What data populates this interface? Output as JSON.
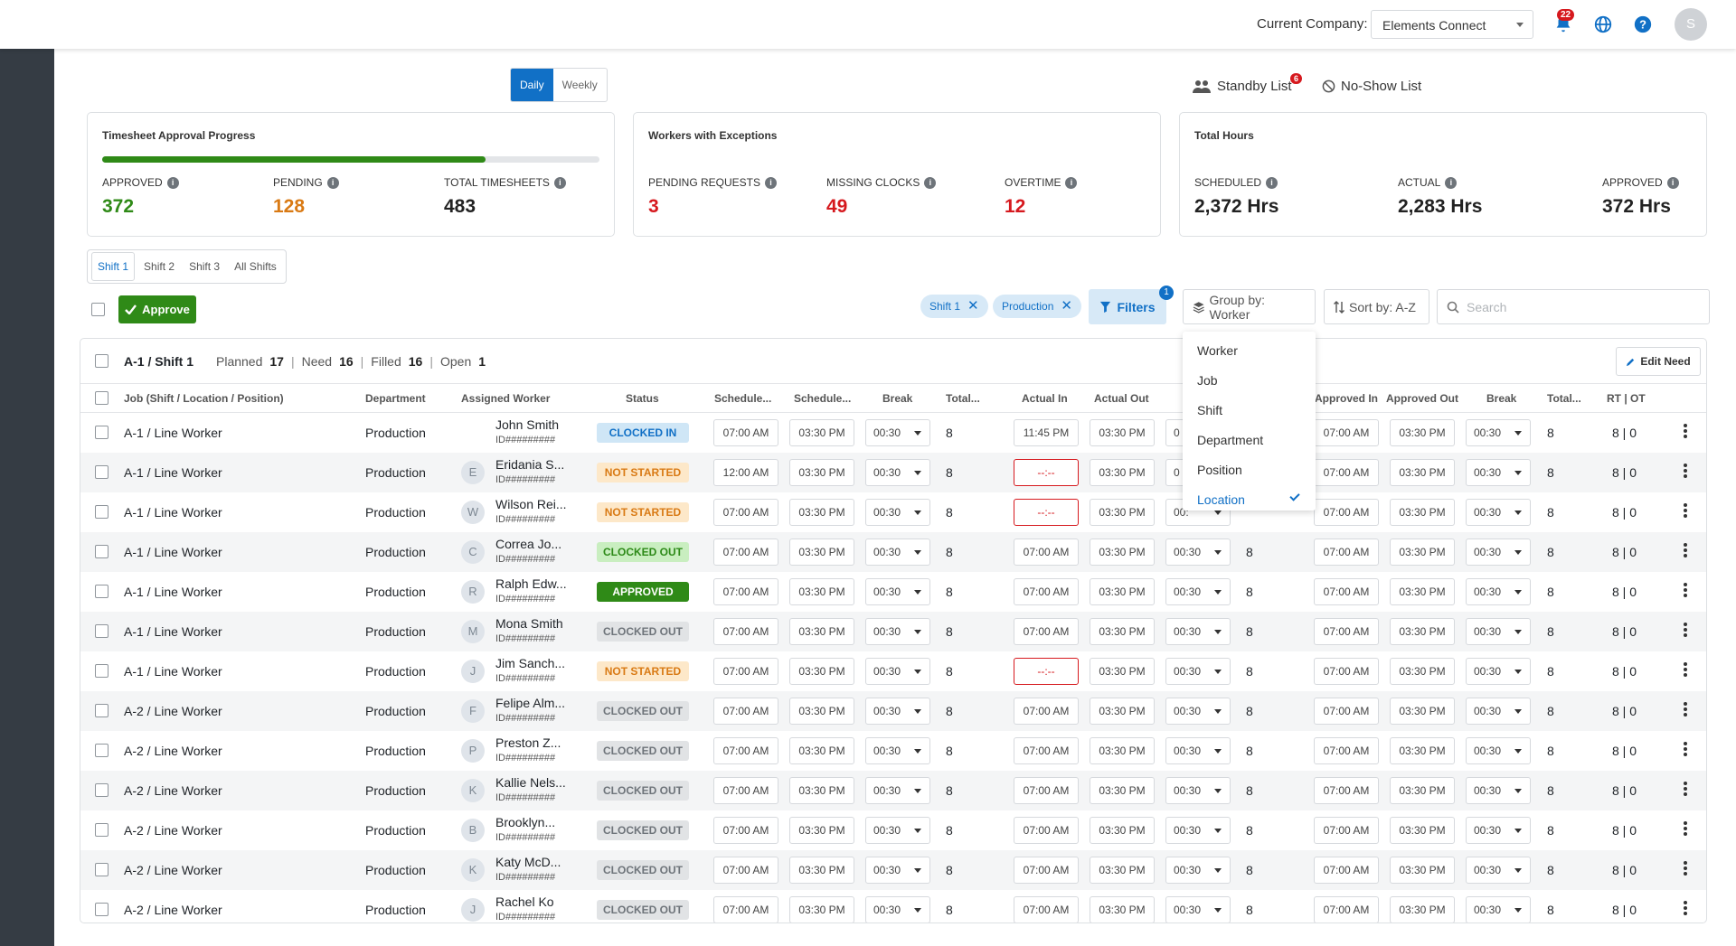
{
  "header": {
    "company_label": "Current Company:",
    "company_value": "Elements Connect",
    "notification_count": "22",
    "avatar_initial": "S"
  },
  "view_toggle": {
    "daily": "Daily",
    "weekly": "Weekly",
    "selected": "Daily"
  },
  "links": {
    "standby": "Standby List",
    "standby_count": "6",
    "noshow": "No-Show List"
  },
  "cards": {
    "approval": {
      "title": "Timesheet Approval Progress",
      "progress_fraction": 0.77,
      "metrics": [
        {
          "label": "APPROVED",
          "value": "372",
          "color": "#2f8a17"
        },
        {
          "label": "PENDING",
          "value": "128",
          "color": "#d97a14"
        },
        {
          "label": "TOTAL TIMESHEETS",
          "value": "483",
          "color": "#222222"
        }
      ]
    },
    "exceptions": {
      "title": "Workers with Exceptions",
      "metrics": [
        {
          "label": "PENDING REQUESTS",
          "value": "3",
          "color": "#d6191e"
        },
        {
          "label": "MISSING CLOCKS",
          "value": "49",
          "color": "#d6191e"
        },
        {
          "label": "OVERTIME",
          "value": "12",
          "color": "#d6191e"
        }
      ]
    },
    "hours": {
      "title": "Total Hours",
      "metrics": [
        {
          "label": "SCHEDULED",
          "value": "2,372 Hrs",
          "color": "#222222"
        },
        {
          "label": "ACTUAL",
          "value": "2,283 Hrs",
          "color": "#222222"
        },
        {
          "label": "APPROVED",
          "value": "372 Hrs",
          "color": "#222222"
        }
      ]
    }
  },
  "shift_tabs": [
    "Shift 1",
    "Shift 2",
    "Shift 3",
    "All Shifts"
  ],
  "toolbar": {
    "approve_label": "Approve",
    "chips": [
      "Shift 1",
      "Production"
    ],
    "filters_label": "Filters",
    "filters_count": "1",
    "group_by_label": "Group by: Worker",
    "sort_by_label": "Sort by: A-Z",
    "search_placeholder": "Search"
  },
  "group_by_menu": {
    "items": [
      "Worker",
      "Job",
      "Shift",
      "Department",
      "Position",
      "Location"
    ],
    "selected": "Location"
  },
  "group": {
    "name": "A-1 / Shift 1",
    "planned_label": "Planned",
    "planned": "17",
    "need_label": "Need",
    "need": "16",
    "filled_label": "Filled",
    "filled": "16",
    "open_label": "Open",
    "open": "1",
    "edit_need_label": "Edit Need"
  },
  "columns": [
    "Job (Shift / Location / Position)",
    "Department",
    "Assigned Worker",
    "Status",
    "Schedule...",
    "Schedule...",
    "Break",
    "Total...",
    "Actual In",
    "Actual Out",
    "Approved In",
    "Approved Out",
    "Break",
    "Total...",
    "RT | OT"
  ],
  "rows": [
    {
      "job": "A-1 / Line Worker",
      "dept": "Production",
      "initial": "",
      "name": "John Smith",
      "id": "ID#########",
      "status": "CLOCKED IN",
      "st": "in",
      "sin": "07:00 AM",
      "sout": "03:30 PM",
      "brk": "00:30",
      "total": "8",
      "ain": "11:45 PM",
      "aout": "03:30 PM",
      "abrk": "0",
      "atotal": "",
      "pin": "07:00 AM",
      "pout": "03:30 PM",
      "pbrk": "00:30",
      "ptotal": "8",
      "rtot": "8 | 0",
      "err": false
    },
    {
      "job": "A-1 / Line Worker",
      "dept": "Production",
      "initial": "E",
      "name": "Eridania S...",
      "id": "ID#########",
      "status": "NOT STARTED",
      "st": "ns",
      "sin": "12:00 AM",
      "sout": "03:30 PM",
      "brk": "00:30",
      "total": "8",
      "ain": "--:--",
      "aout": "03:30 PM",
      "abrk": "0",
      "atotal": "",
      "pin": "07:00 AM",
      "pout": "03:30 PM",
      "pbrk": "00:30",
      "ptotal": "8",
      "rtot": "8 | 0",
      "err": true
    },
    {
      "job": "A-1 / Line Worker",
      "dept": "Production",
      "initial": "W",
      "name": "Wilson Rei...",
      "id": "ID#########",
      "status": "NOT STARTED",
      "st": "ns",
      "sin": "07:00 AM",
      "sout": "03:30 PM",
      "brk": "00:30",
      "total": "8",
      "ain": "--:--",
      "aout": "03:30 PM",
      "abrk": "00:",
      "atotal": "",
      "pin": "07:00 AM",
      "pout": "03:30 PM",
      "pbrk": "00:30",
      "ptotal": "8",
      "rtot": "8 | 0",
      "err": true
    },
    {
      "job": "A-1 / Line Worker",
      "dept": "Production",
      "initial": "C",
      "name": "Correa Jo...",
      "id": "ID#########",
      "status": "CLOCKED OUT",
      "st": "co",
      "sin": "07:00 AM",
      "sout": "03:30 PM",
      "brk": "00:30",
      "total": "8",
      "ain": "07:00 AM",
      "aout": "03:30 PM",
      "abrk": "00:30",
      "atotal": "8",
      "pin": "07:00 AM",
      "pout": "03:30 PM",
      "pbrk": "00:30",
      "ptotal": "8",
      "rtot": "8 | 0",
      "err": false
    },
    {
      "job": "A-1 / Line Worker",
      "dept": "Production",
      "initial": "R",
      "name": "Ralph Edw...",
      "id": "ID#########",
      "status": "APPROVED",
      "st": "ap",
      "sin": "07:00 AM",
      "sout": "03:30 PM",
      "brk": "00:30",
      "total": "8",
      "ain": "07:00 AM",
      "aout": "03:30 PM",
      "abrk": "00:30",
      "atotal": "8",
      "pin": "07:00 AM",
      "pout": "03:30 PM",
      "pbrk": "00:30",
      "ptotal": "8",
      "rtot": "8 | 0",
      "err": false
    },
    {
      "job": "A-1 / Line Worker",
      "dept": "Production",
      "initial": "M",
      "name": "Mona Smith",
      "id": "ID#########",
      "status": "CLOCKED OUT",
      "st": "gr",
      "sin": "07:00 AM",
      "sout": "03:30 PM",
      "brk": "00:30",
      "total": "8",
      "ain": "07:00 AM",
      "aout": "03:30 PM",
      "abrk": "00:30",
      "atotal": "8",
      "pin": "07:00 AM",
      "pout": "03:30 PM",
      "pbrk": "00:30",
      "ptotal": "8",
      "rtot": "8 | 0",
      "err": false
    },
    {
      "job": "A-1 / Line Worker",
      "dept": "Production",
      "initial": "J",
      "name": "Jim Sanch...",
      "id": "ID#########",
      "status": "NOT STARTED",
      "st": "ns",
      "sin": "07:00 AM",
      "sout": "03:30 PM",
      "brk": "00:30",
      "total": "8",
      "ain": "--:--",
      "aout": "03:30 PM",
      "abrk": "00:30",
      "atotal": "8",
      "pin": "07:00 AM",
      "pout": "03:30 PM",
      "pbrk": "00:30",
      "ptotal": "8",
      "rtot": "8 | 0",
      "err": true
    },
    {
      "job": "A-2 / Line Worker",
      "dept": "Production",
      "initial": "F",
      "name": "Felipe Alm...",
      "id": "ID#########",
      "status": "CLOCKED OUT",
      "st": "gr",
      "sin": "07:00 AM",
      "sout": "03:30 PM",
      "brk": "00:30",
      "total": "8",
      "ain": "07:00 AM",
      "aout": "03:30 PM",
      "abrk": "00:30",
      "atotal": "8",
      "pin": "07:00 AM",
      "pout": "03:30 PM",
      "pbrk": "00:30",
      "ptotal": "8",
      "rtot": "8 | 0",
      "err": false
    },
    {
      "job": "A-2 / Line Worker",
      "dept": "Production",
      "initial": "P",
      "name": "Preston Z...",
      "id": "ID#########",
      "status": "CLOCKED OUT",
      "st": "gr",
      "sin": "07:00 AM",
      "sout": "03:30 PM",
      "brk": "00:30",
      "total": "8",
      "ain": "07:00 AM",
      "aout": "03:30 PM",
      "abrk": "00:30",
      "atotal": "8",
      "pin": "07:00 AM",
      "pout": "03:30 PM",
      "pbrk": "00:30",
      "ptotal": "8",
      "rtot": "8 | 0",
      "err": false
    },
    {
      "job": "A-2 / Line Worker",
      "dept": "Production",
      "initial": "K",
      "name": "Kallie Nels...",
      "id": "ID#########",
      "status": "CLOCKED OUT",
      "st": "gr",
      "sin": "07:00 AM",
      "sout": "03:30 PM",
      "brk": "00:30",
      "total": "8",
      "ain": "07:00 AM",
      "aout": "03:30 PM",
      "abrk": "00:30",
      "atotal": "8",
      "pin": "07:00 AM",
      "pout": "03:30 PM",
      "pbrk": "00:30",
      "ptotal": "8",
      "rtot": "8 | 0",
      "err": false
    },
    {
      "job": "A-2 / Line Worker",
      "dept": "Production",
      "initial": "B",
      "name": "Brooklyn...",
      "id": "ID#########",
      "status": "CLOCKED OUT",
      "st": "gr",
      "sin": "07:00 AM",
      "sout": "03:30 PM",
      "brk": "00:30",
      "total": "8",
      "ain": "07:00 AM",
      "aout": "03:30 PM",
      "abrk": "00:30",
      "atotal": "8",
      "pin": "07:00 AM",
      "pout": "03:30 PM",
      "pbrk": "00:30",
      "ptotal": "8",
      "rtot": "8 | 0",
      "err": false
    },
    {
      "job": "A-2 / Line Worker",
      "dept": "Production",
      "initial": "K",
      "name": "Katy McD...",
      "id": "ID#########",
      "status": "CLOCKED OUT",
      "st": "gr",
      "sin": "07:00 AM",
      "sout": "03:30 PM",
      "brk": "00:30",
      "total": "8",
      "ain": "07:00 AM",
      "aout": "03:30 PM",
      "abrk": "00:30",
      "atotal": "8",
      "pin": "07:00 AM",
      "pout": "03:30 PM",
      "pbrk": "00:30",
      "ptotal": "8",
      "rtot": "8 | 0",
      "err": false
    },
    {
      "job": "A-2 / Line Worker",
      "dept": "Production",
      "initial": "J",
      "name": "Rachel Ko",
      "id": "ID#########",
      "status": "CLOCKED OUT",
      "st": "gr",
      "sin": "07:00 AM",
      "sout": "03:30 PM",
      "brk": "00:30",
      "total": "8",
      "ain": "07:00 AM",
      "aout": "03:30 PM",
      "abrk": "00:30",
      "atotal": "8",
      "pin": "07:00 AM",
      "pout": "03:30 PM",
      "pbrk": "00:30",
      "ptotal": "8",
      "rtot": "8 | 0",
      "err": false
    }
  ]
}
